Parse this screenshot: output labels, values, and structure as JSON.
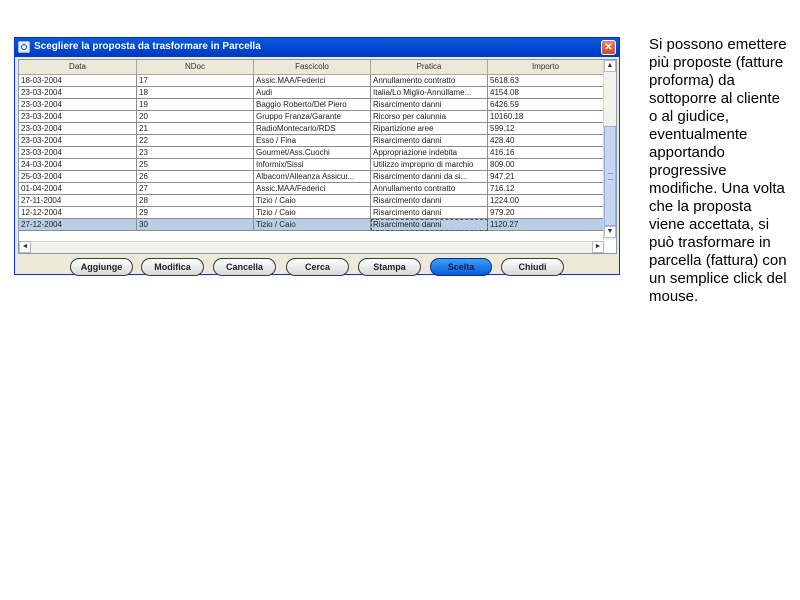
{
  "window": {
    "title": "Scegliere la proposta da trasformare in Parcella",
    "close_symbol": "✕"
  },
  "table": {
    "columns": [
      "Data",
      "NDoc",
      "Fascicolo",
      "Pratica",
      "Importo"
    ],
    "rows": [
      [
        "18-03-2004",
        "17",
        "Assic.MAA/Federici",
        "Annullamento contratto",
        "5618.63"
      ],
      [
        "23-03-2004",
        "18",
        "Audi",
        "Italia/Lo Miglio-Annullame...",
        "4154.08"
      ],
      [
        "23-03-2004",
        "19",
        "Baggio Roberto/Del Piero",
        "Risarcimento danni",
        "6426.59"
      ],
      [
        "23-03-2004",
        "20",
        "Gruppo Franza/Garante",
        "Ricorso per calunnia",
        "10160.18"
      ],
      [
        "23-03-2004",
        "21",
        "RadioMontecarlo/RDS",
        "Ripartizione aree",
        "599.12"
      ],
      [
        "23-03-2004",
        "22",
        "Esso / Fina",
        "Risarcimento danni",
        "428.40"
      ],
      [
        "23-03-2004",
        "23",
        "Gourmet/Ass.Cuochi",
        "Appropriazione indebita",
        "416.16"
      ],
      [
        "24-03-2004",
        "25",
        "Informix/Sissi",
        "Utilizzo improprio di marchio",
        "809.00"
      ],
      [
        "25-03-2004",
        "26",
        "Albacom/Alleanza Assicur...",
        "Risarcimento danni da si...",
        "947.21"
      ],
      [
        "01-04-2004",
        "27",
        "Assic.MAA/Federici",
        "Annullamento contratto",
        "716.12"
      ],
      [
        "27-11-2004",
        "28",
        "Tizio / Caio",
        "Risarcimento danni",
        "1224.00"
      ],
      [
        "12-12-2004",
        "29",
        "Tizio / Caio",
        "Risarcimento danni",
        "979.20"
      ],
      [
        "27-12-2004",
        "30",
        "Tizio / Caio",
        "Risarcimento danni",
        "1120.27"
      ]
    ],
    "selected_row": 12
  },
  "buttons": {
    "aggiunge": "Aggiunge",
    "modifica": "Modifica",
    "cancella": "Cancella",
    "cerca": "Cerca",
    "stampa": "Stampa",
    "scelta": "Scelta",
    "chiudi": "Chiudi"
  },
  "scroll": {
    "up": "▲",
    "down": "▼",
    "left": "◄",
    "right": "►"
  },
  "help_text": "Si possono emettere più proposte (fatture proforma) da sottoporre al cliente o al giudice, eventualmente apportando progressive modifiche. Una volta che la proposta viene accettata, si può trasformare in parcella (fattura) con un semplice click del mouse.",
  "colors": {
    "titlebar": "#0045d0",
    "selected_row": "#b8cfe5",
    "primary_button": "#0a5ad8"
  }
}
